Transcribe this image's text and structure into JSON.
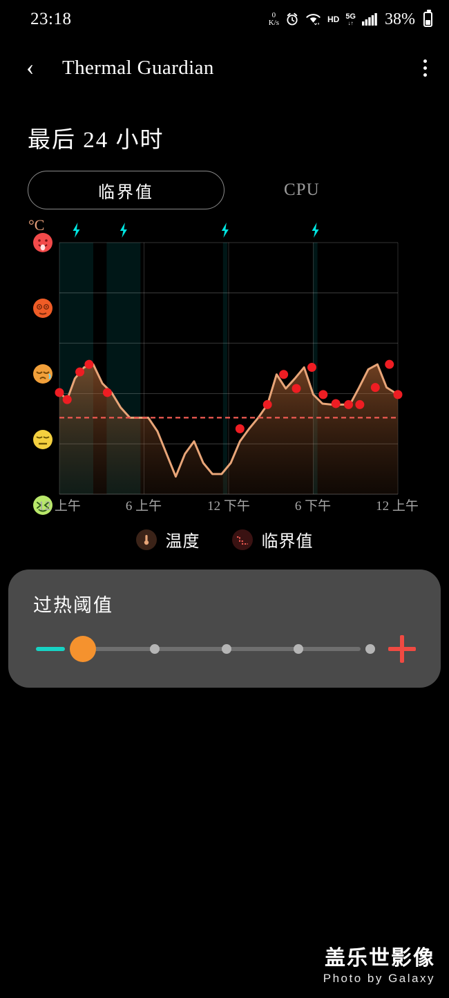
{
  "statusbar": {
    "time": "23:18",
    "netspeed_value": "0",
    "netspeed_unit": "K/s",
    "alarm_icon": "alarm-clock-icon",
    "wifi_icon": "wifi-icon",
    "hd_label": "HD",
    "network_label": "5G",
    "signal_icon": "signal-bars-icon",
    "battery_percent": "38%",
    "battery_icon": "battery-icon"
  },
  "appbar": {
    "back_icon": "back-chevron-icon",
    "title": "Thermal Guardian",
    "overflow_icon": "overflow-menu-icon"
  },
  "headline": "最后 24 小时",
  "tabs": [
    {
      "label": "临界值",
      "selected": true
    },
    {
      "label": "CPU",
      "selected": false
    }
  ],
  "legend": [
    {
      "label": "温度",
      "icon": "thermometer-icon",
      "color": "#e8a578"
    },
    {
      "label": "临界值",
      "icon": "threshold-dashed-line-icon",
      "color": "#e8574f"
    }
  ],
  "threshold_card": {
    "title": "过热阈值",
    "decrease_icon": "minus-icon",
    "increase_icon": "plus-icon",
    "decrease_color": "#17d3c4",
    "increase_color": "#f04a42",
    "thumb_color": "#f5922e",
    "steps": 5,
    "selected_step": 1
  },
  "watermark": {
    "cn": "盖乐世影像",
    "en": "Photo by Galaxy"
  },
  "chart_data": {
    "type": "area",
    "title": "最后 24 小时",
    "xlabel": "",
    "ylabel": "°C",
    "y_unit": "°C",
    "xtick_labels": [
      "12 上午",
      "6 上午",
      "12 下午",
      "6 下午",
      "12 上午"
    ],
    "xtick_positions": [
      0,
      6,
      12,
      18,
      24
    ],
    "xlim": [
      0,
      24
    ],
    "ylim": [
      0,
      5
    ],
    "grid": true,
    "y_axis_icons": [
      {
        "name": "hot-face-emoji",
        "level": 5,
        "color": "#ef3b42"
      },
      {
        "name": "exploding-head-emoji",
        "level": 4,
        "color": "#f0532a"
      },
      {
        "name": "weary-face-emoji",
        "level": 3,
        "color": "#f5a623"
      },
      {
        "name": "confounded-face-emoji",
        "level": 2,
        "color": "#f2d03b"
      },
      {
        "name": "cold-face-emoji",
        "level": 1,
        "color": "#bfe86a"
      }
    ],
    "threshold_line": {
      "label": "临界值",
      "value": 1.52,
      "style": "dashed",
      "color": "#e8574f"
    },
    "series": [
      {
        "name": "温度",
        "color": "#e8a578",
        "marker_color": "#ee1d23",
        "x": [
          0.0,
          0.55,
          1.1,
          1.75,
          2.4,
          3.05,
          3.7,
          4.35,
          5.0,
          5.65,
          6.3,
          6.95,
          7.6,
          8.25,
          8.9,
          9.55,
          10.2,
          10.85,
          11.5,
          12.15,
          12.8,
          13.45,
          14.1,
          14.75,
          15.4,
          16.05,
          16.7,
          17.35,
          18.0,
          18.65,
          19.3,
          19.95,
          20.6,
          21.25,
          21.9,
          22.55,
          23.2,
          24.0
        ],
        "y": [
          2.02,
          1.88,
          2.3,
          2.52,
          2.58,
          2.2,
          2.02,
          1.72,
          1.52,
          1.52,
          1.52,
          1.25,
          0.8,
          0.35,
          0.8,
          1.05,
          0.62,
          0.4,
          0.4,
          0.62,
          1.05,
          1.3,
          1.52,
          1.78,
          2.38,
          2.1,
          2.3,
          2.52,
          1.98,
          1.8,
          1.78,
          1.78,
          1.78,
          2.12,
          2.48,
          2.58,
          2.12,
          1.98
        ],
        "marker_x": [
          0.0,
          0.55,
          1.45,
          2.1,
          3.4,
          12.8,
          14.75,
          15.9,
          16.8,
          17.9,
          18.7,
          19.6,
          20.5,
          21.3,
          22.4,
          23.4,
          24.0
        ],
        "marker_y": [
          2.02,
          1.88,
          2.43,
          2.58,
          2.02,
          1.3,
          1.78,
          2.38,
          2.1,
          2.52,
          1.98,
          1.8,
          1.78,
          1.78,
          2.12,
          2.58,
          1.98
        ]
      }
    ],
    "charging_sessions": [
      {
        "icon": "lightning-bolt-icon",
        "start": 0.0,
        "end": 2.4,
        "color": "#00e5e0"
      },
      {
        "icon": "lightning-bolt-icon",
        "start": 3.35,
        "end": 5.75,
        "color": "#00e5e0"
      },
      {
        "icon": "lightning-bolt-icon",
        "start": 11.6,
        "end": 11.9,
        "color": "#00e5e0"
      },
      {
        "icon": "lightning-bolt-icon",
        "start": 18.0,
        "end": 18.3,
        "color": "#00e5e0"
      }
    ]
  }
}
